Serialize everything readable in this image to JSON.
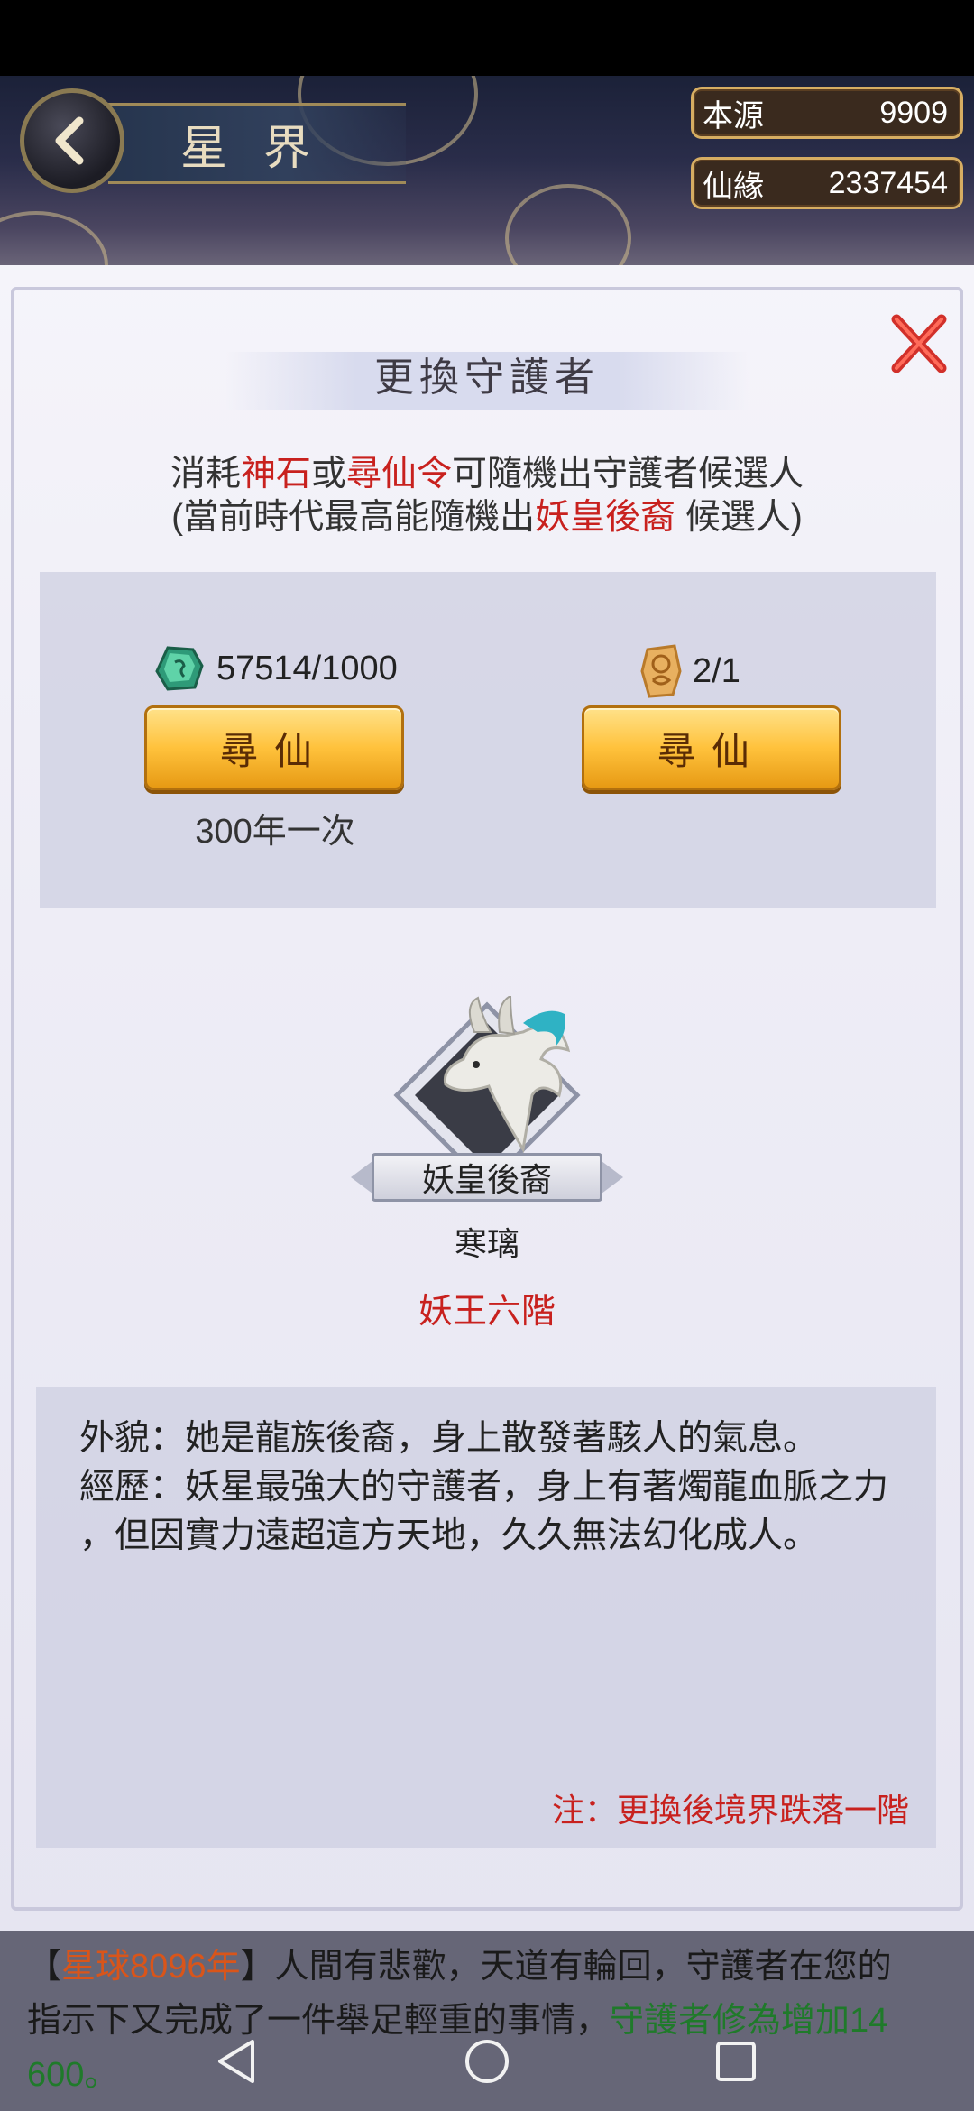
{
  "header": {
    "title": "星界",
    "resources": [
      {
        "label": "本源",
        "value": "9909"
      },
      {
        "label": "仙緣",
        "value": "2337454"
      }
    ]
  },
  "dialog": {
    "title": "更換守護者",
    "desc_line1": {
      "a": "消耗",
      "b": "神石",
      "c": "或",
      "d": "尋仙令",
      "e": "可隨機出守護者候選人"
    },
    "desc_line2": {
      "a": "(當前時代最高能隨機出",
      "b": "妖皇後裔",
      "c": " 候選人)"
    },
    "cost_stone": "57514/1000",
    "cost_token": "2/1",
    "seek_button_1": "尋仙",
    "seek_button_2": "尋仙",
    "seek_note": "300年一次",
    "candidate": {
      "tag": "妖皇後裔",
      "name": "寒璃",
      "rank": "妖王六階"
    },
    "bio_line1": "外貌：她是龍族後裔，身上散發著駭人的氣息。",
    "bio_line2": "經歷：妖星最強大的守護者，身上有著燭龍血脈之力",
    "bio_line3": "，但因實力遠超這方天地，久久無法幻化成人。",
    "note": "注：更換後境界跌落一階"
  },
  "message": {
    "p1": "【",
    "year": "星球8096年",
    "p2": "】人間有悲歡，天道有輪回，守護者在您的",
    "line2a": "指示下又完成了一件舉足輕重的事情，",
    "line2b": "守護者修為增加14",
    "line3": "600。"
  },
  "colors": {
    "accent_red": "#c8211e",
    "button_gold": "#ffc23c",
    "highlight_green": "#1f7a2a",
    "highlight_orange": "#d9551a"
  },
  "icons": [
    "back-arrow-icon",
    "close-x-icon",
    "spirit-stone-icon",
    "seek-token-icon",
    "nav-back-icon",
    "nav-home-icon",
    "nav-recent-icon"
  ]
}
